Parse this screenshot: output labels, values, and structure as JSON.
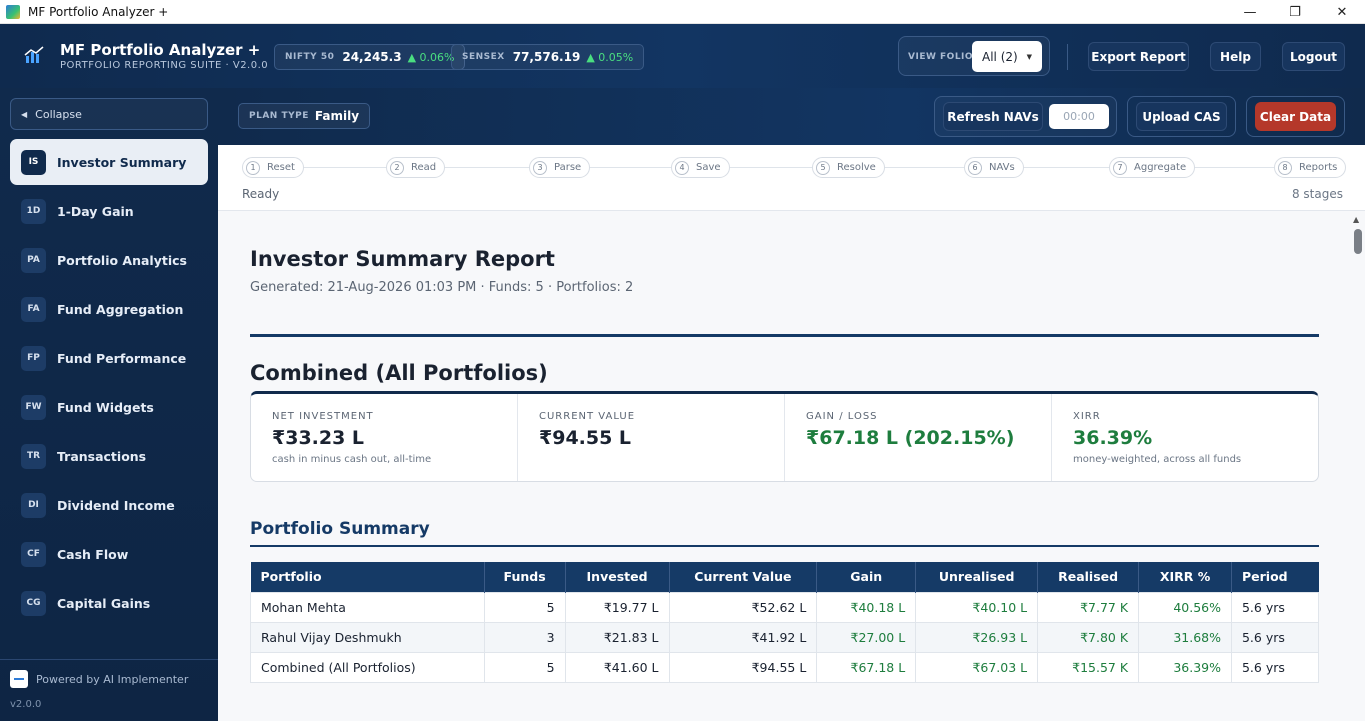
{
  "window": {
    "title": "MF Portfolio Analyzer +"
  },
  "header": {
    "title": "MF Portfolio Analyzer +",
    "subtitle": "PORTFOLIO REPORTING SUITE · V2.0.0",
    "tickers": [
      {
        "label": "NIFTY 50",
        "value": "24,245.3",
        "change": "▲ 0.06%"
      },
      {
        "label": "SENSEX",
        "value": "77,576.19",
        "change": "▲ 0.05%"
      }
    ],
    "view_folio": {
      "label": "VIEW FOLIO",
      "value": "All (2)"
    },
    "buttons": {
      "export": "Export Report",
      "help": "Help",
      "logout": "Logout"
    }
  },
  "sidebar": {
    "collapse_label": "Collapse",
    "items": [
      {
        "abbr": "IS",
        "label": "Investor Summary"
      },
      {
        "abbr": "1D",
        "label": "1-Day Gain"
      },
      {
        "abbr": "PA",
        "label": "Portfolio Analytics"
      },
      {
        "abbr": "FA",
        "label": "Fund Aggregation"
      },
      {
        "abbr": "FP",
        "label": "Fund Performance"
      },
      {
        "abbr": "FW",
        "label": "Fund Widgets"
      },
      {
        "abbr": "TR",
        "label": "Transactions"
      },
      {
        "abbr": "DI",
        "label": "Dividend Income"
      },
      {
        "abbr": "CF",
        "label": "Cash Flow"
      },
      {
        "abbr": "CG",
        "label": "Capital Gains"
      }
    ],
    "powered_by": "Powered by AI Implementer",
    "version": "v2.0.0"
  },
  "toolbar": {
    "plan_type_label": "PLAN TYPE",
    "plan_type_value": "Family",
    "refresh_label": "Refresh NAVs",
    "timer_placeholder": "00:00",
    "upload_label": "Upload CAS",
    "clear_label": "Clear Data"
  },
  "stages": {
    "items": [
      {
        "num": "1",
        "label": "Reset"
      },
      {
        "num": "2",
        "label": "Read"
      },
      {
        "num": "3",
        "label": "Parse"
      },
      {
        "num": "4",
        "label": "Save"
      },
      {
        "num": "5",
        "label": "Resolve"
      },
      {
        "num": "6",
        "label": "NAVs"
      },
      {
        "num": "7",
        "label": "Aggregate"
      },
      {
        "num": "8",
        "label": "Reports"
      }
    ],
    "status": "Ready",
    "count": "8 stages"
  },
  "report": {
    "title": "Investor Summary Report",
    "generated": "Generated: 21-Aug-2026 01:03 PM · Funds: 5 · Portfolios: 2",
    "combined_title": "Combined (All Portfolios)",
    "kpis": [
      {
        "label": "NET INVESTMENT",
        "value": "₹33.23 L",
        "note": "cash in minus cash out, all-time"
      },
      {
        "label": "CURRENT VALUE",
        "value": "₹94.55 L",
        "note": ""
      },
      {
        "label": "GAIN / LOSS",
        "value": "₹67.18 L (202.15%)",
        "note": ""
      },
      {
        "label": "XIRR",
        "value": "36.39%",
        "note": "money-weighted, across all funds"
      }
    ],
    "portfolio_summary_title": "Portfolio Summary",
    "table": {
      "headers": [
        "Portfolio",
        "Funds",
        "Invested",
        "Current Value",
        "Gain",
        "Unrealised",
        "Realised",
        "XIRR %",
        "Period"
      ],
      "rows": [
        [
          "Mohan Mehta",
          "5",
          "₹19.77 L",
          "₹52.62 L",
          "₹40.18 L",
          "₹40.10 L",
          "₹7.77 K",
          "40.56%",
          "5.6 yrs"
        ],
        [
          "Rahul Vijay Deshmukh",
          "3",
          "₹21.83 L",
          "₹41.92 L",
          "₹27.00 L",
          "₹26.93 L",
          "₹7.80 K",
          "31.68%",
          "5.6 yrs"
        ],
        [
          "Combined (All Portfolios)",
          "5",
          "₹41.60 L",
          "₹94.55 L",
          "₹67.18 L",
          "₹67.03 L",
          "₹15.57 K",
          "36.39%",
          "5.6 yrs"
        ]
      ]
    }
  },
  "colors": {
    "navy": "#102a4c",
    "accent_green": "#1e7d3e",
    "danger": "#b5382a",
    "ticker_up": "#4ade80"
  }
}
